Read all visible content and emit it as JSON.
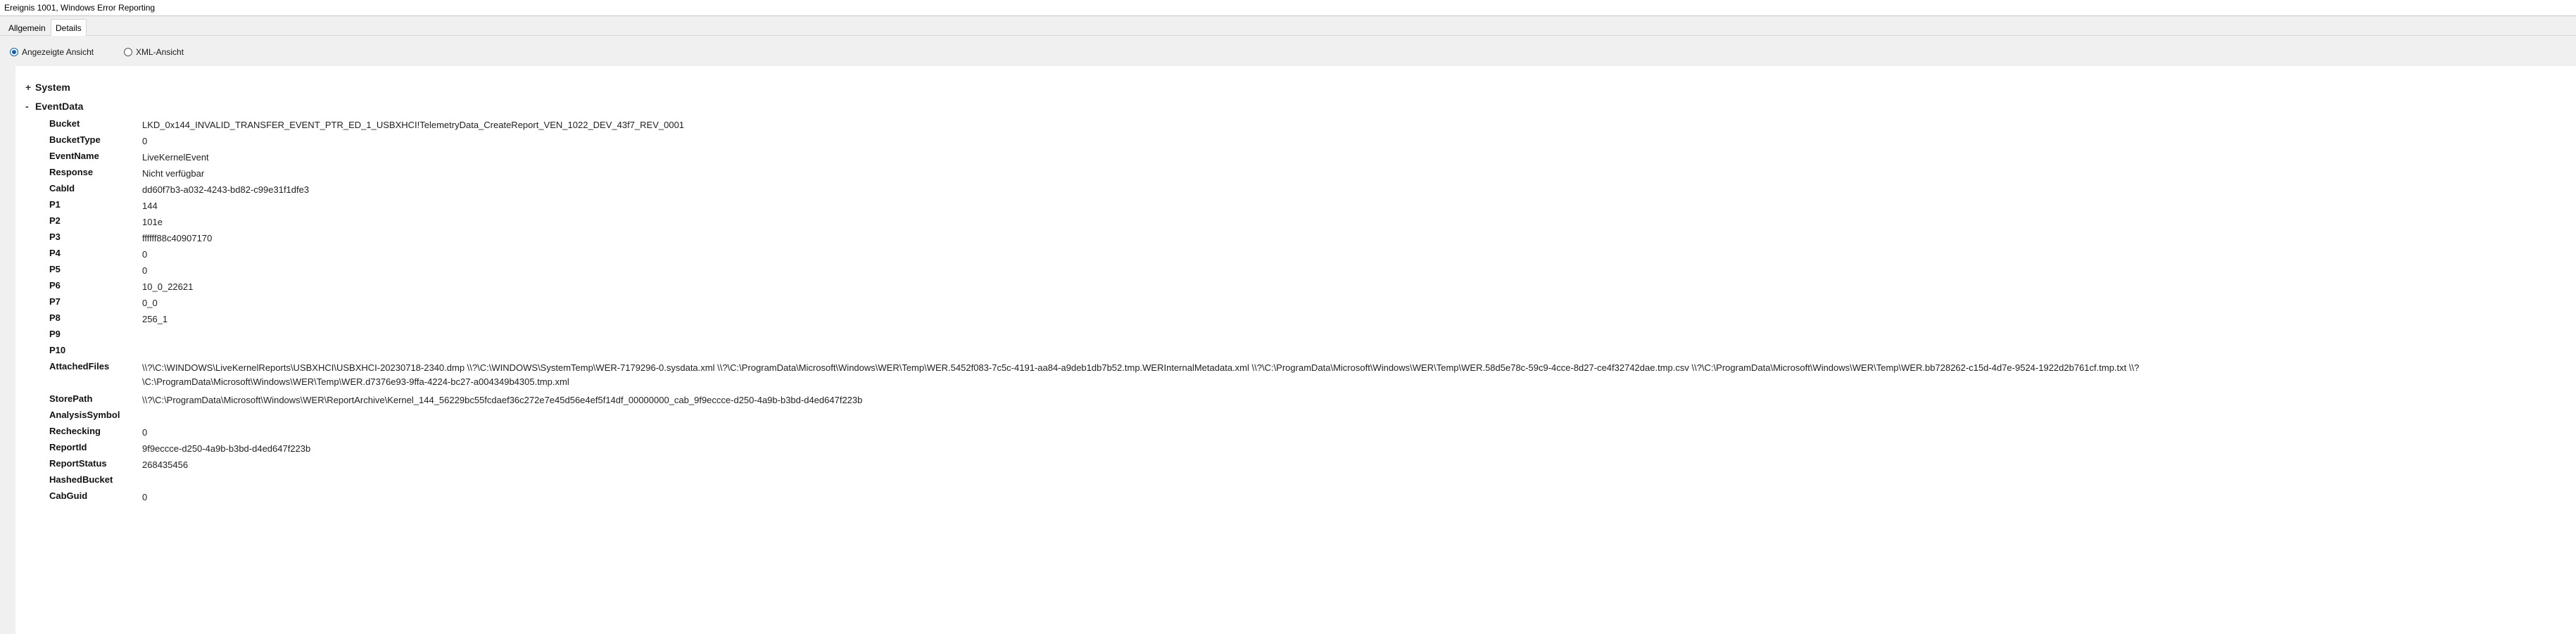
{
  "window": {
    "title": "Ereignis 1001, Windows Error Reporting"
  },
  "tabs": [
    {
      "label": "Allgemein",
      "selected": false
    },
    {
      "label": "Details",
      "selected": true
    }
  ],
  "view_options": [
    {
      "label": "Angezeigte Ansicht",
      "selected": true
    },
    {
      "label": "XML-Ansicht",
      "selected": false
    }
  ],
  "tree": {
    "system": {
      "toggle": "+",
      "label": "System"
    },
    "eventdata": {
      "toggle": "-",
      "label": "EventData"
    }
  },
  "eventdata": [
    {
      "key": "Bucket",
      "value": "LKD_0x144_INVALID_TRANSFER_EVENT_PTR_ED_1_USBXHCI!TelemetryData_CreateReport_VEN_1022_DEV_43f7_REV_0001"
    },
    {
      "key": "BucketType",
      "value": "0"
    },
    {
      "key": "EventName",
      "value": "LiveKernelEvent"
    },
    {
      "key": "Response",
      "value": "Nicht verfügbar"
    },
    {
      "key": "CabId",
      "value": "dd60f7b3-a032-4243-bd82-c99e31f1dfe3"
    },
    {
      "key": "P1",
      "value": "144"
    },
    {
      "key": "P2",
      "value": "101e"
    },
    {
      "key": "P3",
      "value": "ffffff88c40907170"
    },
    {
      "key": "P4",
      "value": "0"
    },
    {
      "key": "P5",
      "value": "0"
    },
    {
      "key": "P6",
      "value": "10_0_22621"
    },
    {
      "key": "P7",
      "value": "0_0"
    },
    {
      "key": "P8",
      "value": "256_1"
    },
    {
      "key": "P9",
      "value": ""
    },
    {
      "key": "P10",
      "value": ""
    },
    {
      "key": "AttachedFiles",
      "value": "\\\\?\\C:\\WINDOWS\\LiveKernelReports\\USBXHCI\\USBXHCI-20230718-2340.dmp \\\\?\\C:\\WINDOWS\\SystemTemp\\WER-7179296-0.sysdata.xml \\\\?\\C:\\ProgramData\\Microsoft\\Windows\\WER\\Temp\\WER.5452f083-7c5c-4191-aa84-a9deb1db7b52.tmp.WERInternalMetadata.xml \\\\?\\C:\\ProgramData\\Microsoft\\Windows\\WER\\Temp\\WER.58d5e78c-59c9-4cce-8d27-ce4f32742dae.tmp.csv \\\\?\\C:\\ProgramData\\Microsoft\\Windows\\WER\\Temp\\WER.bb728262-c15d-4d7e-9524-1922d2b761cf.tmp.txt \\\\?",
      "value_line2": "\\C:\\ProgramData\\Microsoft\\Windows\\WER\\Temp\\WER.d7376e93-9ffa-4224-bc27-a004349b4305.tmp.xml"
    },
    {
      "key": "StorePath",
      "value": "\\\\?\\C:\\ProgramData\\Microsoft\\Windows\\WER\\ReportArchive\\Kernel_144_56229bc55fcdaef36c272e7e45d56e4ef5f14df_00000000_cab_9f9eccce-d250-4a9b-b3bd-d4ed647f223b"
    },
    {
      "key": "AnalysisSymbol",
      "value": ""
    },
    {
      "key": "Rechecking",
      "value": "0"
    },
    {
      "key": "ReportId",
      "value": "9f9eccce-d250-4a9b-b3bd-d4ed647f223b"
    },
    {
      "key": "ReportStatus",
      "value": "268435456"
    },
    {
      "key": "HashedBucket",
      "value": ""
    },
    {
      "key": "CabGuid",
      "value": "0"
    }
  ]
}
